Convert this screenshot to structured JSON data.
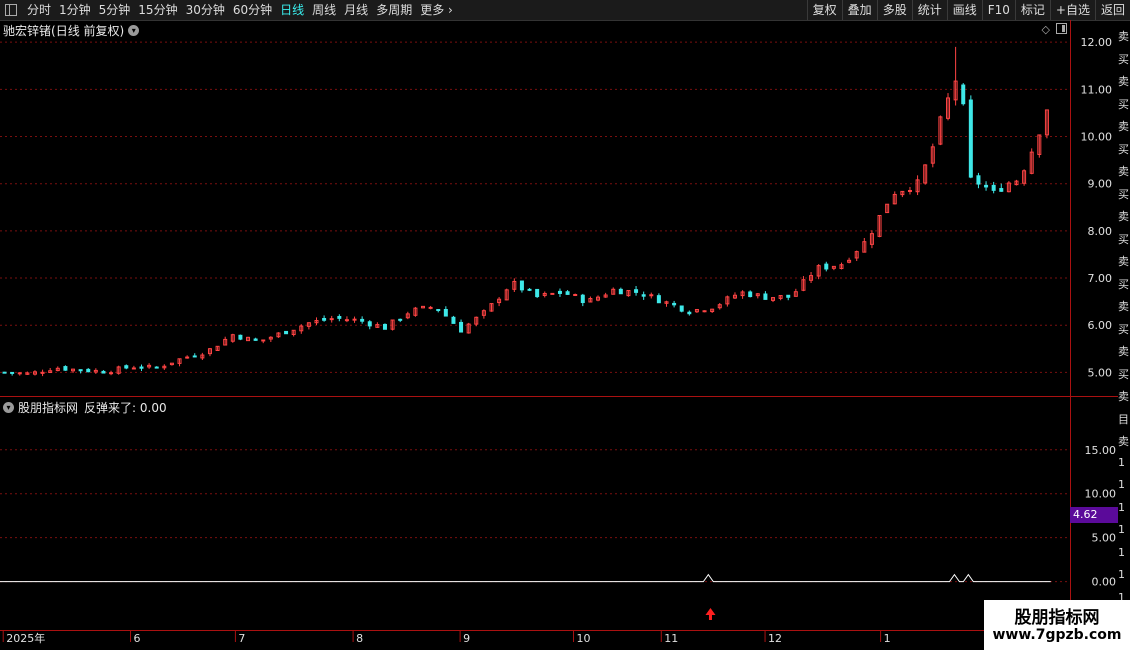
{
  "toolbar": {
    "periods": [
      "分时",
      "1分钟",
      "5分钟",
      "15分钟",
      "30分钟",
      "60分钟",
      "日线",
      "周线",
      "月线",
      "多周期",
      "更多"
    ],
    "active_period": "日线",
    "more_arrow": "›",
    "right_buttons": [
      "复权",
      "叠加",
      "多股",
      "统计",
      "画线",
      "F10",
      "标记",
      "+自选",
      "返回"
    ]
  },
  "stock": {
    "name": "驰宏锌锗",
    "mode": "(日线 前复权)",
    "dropdown_icon": "chevron-down-icon"
  },
  "indicator": {
    "name": "股朋指标网",
    "label": "反弹来了: 0.00",
    "badge_value": "4.62"
  },
  "side_glyphs": [
    "卖",
    "买",
    "卖",
    "买",
    "卖",
    "买",
    "卖",
    "买",
    "卖",
    "买",
    "卖",
    "买",
    "卖",
    "买",
    "卖",
    "买",
    "卖",
    "目",
    "卖",
    "1",
    "1",
    "1",
    "1",
    "1",
    "1",
    "1"
  ],
  "watermark": {
    "line1": "股朋指标网",
    "line2": "www.7gpzb.com"
  },
  "colors": {
    "up": "#ff4444",
    "down": "#3ee8e8",
    "grid": "#7a0f0f",
    "axis": "#aa1111",
    "signal": "#ff2020",
    "text": "#e0e0e0"
  },
  "chart_data": [
    {
      "type": "candlestick",
      "title": "驰宏锌锗 (日线 前复权)",
      "y_ticks": [
        "12.00",
        "11.00",
        "10.00",
        "9.00",
        "8.00",
        "7.00",
        "6.00",
        "5.00"
      ],
      "ylim": [
        4.5,
        12.3
      ],
      "x_ticks": [
        "2025年",
        "6",
        "7",
        "8",
        "9",
        "10",
        "11",
        "12",
        "1"
      ],
      "grid": true,
      "closes_keyframes": [
        [
          0,
          5.0
        ],
        [
          10,
          4.97
        ],
        [
          20,
          5.1
        ],
        [
          30,
          5.05
        ],
        [
          40,
          5.02
        ],
        [
          50,
          5.12
        ],
        [
          60,
          5.1
        ],
        [
          70,
          5.3
        ],
        [
          80,
          5.45
        ],
        [
          90,
          5.8
        ],
        [
          100,
          5.65
        ],
        [
          110,
          5.85
        ],
        [
          120,
          6.05
        ],
        [
          130,
          6.15
        ],
        [
          140,
          6.1
        ],
        [
          150,
          5.95
        ],
        [
          160,
          6.3
        ],
        [
          170,
          6.4
        ],
        [
          180,
          5.9
        ],
        [
          190,
          6.3
        ],
        [
          200,
          6.9
        ],
        [
          210,
          6.6
        ],
        [
          220,
          6.7
        ],
        [
          230,
          6.5
        ],
        [
          240,
          6.75
        ],
        [
          250,
          6.7
        ],
        [
          260,
          6.5
        ],
        [
          270,
          6.3
        ],
        [
          280,
          6.4
        ],
        [
          290,
          6.7
        ],
        [
          300,
          6.6
        ],
        [
          310,
          6.6
        ],
        [
          320,
          7.2
        ],
        [
          330,
          7.3
        ],
        [
          340,
          7.8
        ],
        [
          350,
          8.8
        ],
        [
          360,
          9.0
        ],
        [
          365,
          9.6
        ],
        [
          370,
          10.5
        ],
        [
          375,
          11.2
        ],
        [
          378,
          10.6
        ],
        [
          380,
          9.1
        ],
        [
          385,
          9.0
        ],
        [
          390,
          8.8
        ],
        [
          395,
          9.0
        ],
        [
          400,
          9.1
        ],
        [
          405,
          9.7
        ],
        [
          410,
          10.4
        ],
        [
          413,
          11.0
        ]
      ],
      "highlights": {
        "peak_high": 11.9,
        "peak_index": 375,
        "last_close": 11.0
      }
    },
    {
      "type": "line",
      "series_name": "反弹来了",
      "y_ticks": [
        "15.00",
        "10.00",
        "5.00",
        "0.00"
      ],
      "ylim": [
        -5.5,
        21
      ],
      "baseline": 0,
      "spikes": [
        {
          "x_frac": 0.662,
          "value": 0.8
        },
        {
          "x_frac": 0.892,
          "value": 0.8
        },
        {
          "x_frac": 0.905,
          "value": 0.8
        }
      ],
      "signal_arrow_x_frac": 0.664
    }
  ]
}
